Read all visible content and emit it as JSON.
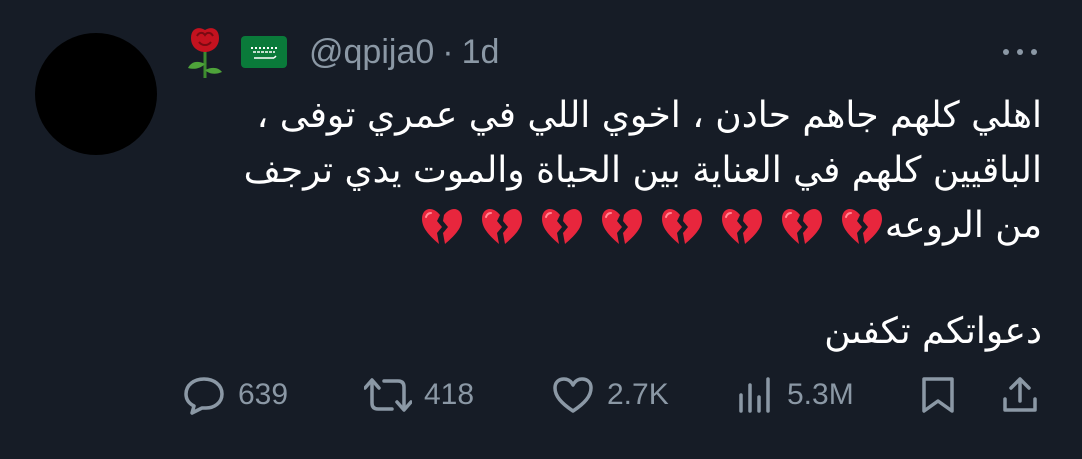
{
  "tweet": {
    "handle": "@qpija0",
    "separator": "·",
    "time": "1d",
    "text_lines": [
      "اهلي كلهم جاهم حادن ، اخوي اللي في عمري توفى ،",
      "الباقيين كلهم في العناية بين الحياة والموت يدي ترجف",
      "من الروعه"
    ],
    "closing_line": "دعواتكم تكفىن",
    "emoji_icons": [
      "rose-icon",
      "saudi-flag-icon"
    ],
    "broken_heart_count": 8
  },
  "actions": {
    "replies": "639",
    "retweets": "418",
    "likes": "2.7K",
    "views": "5.3M"
  },
  "colors": {
    "background": "#161c26",
    "text": "#ffffff",
    "muted": "#8b98a5",
    "heart": "#e8263d"
  }
}
